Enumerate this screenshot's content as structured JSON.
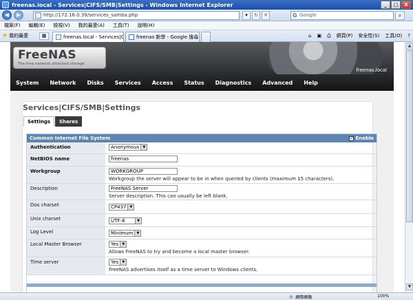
{
  "window": {
    "title": "freenas.local - Services|CIFS/SMB|Settings - Windows Internet Explorer",
    "minimize": "_",
    "maximize": "□",
    "close": "X"
  },
  "browser": {
    "address": "http://172.16.0.39/services_samba.php",
    "search_placeholder": "Google",
    "menu": [
      "檔案(F)",
      "編輯(E)",
      "檢視(V)",
      "我的最愛(A)",
      "工具(T)",
      "說明(H)"
    ],
    "favorites_label": "我的最愛",
    "tabs": [
      {
        "label": "freenas.local - Services|CI...",
        "active": true
      },
      {
        "label": "freenas 新學 - Google 搜尋",
        "active": false
      }
    ],
    "tools": [
      "網頁(P)",
      "安全性(S)",
      "工具(O)"
    ],
    "status_zone": "網際網路",
    "zoom": "100%"
  },
  "header": {
    "logo": "FreeNAS",
    "logo_tagline": "The free network attached storage",
    "hostname": "freenas.local"
  },
  "nav": [
    "System",
    "Network",
    "Disks",
    "Services",
    "Access",
    "Status",
    "Diagnostics",
    "Advanced",
    "Help"
  ],
  "page": {
    "title": "Services|CIFS/SMB|Settings",
    "tabs": [
      "Settings",
      "Shares"
    ]
  },
  "section": {
    "title": "Common Internet File System",
    "enable_label": "Enable",
    "enable_checked": true
  },
  "fields": {
    "authentication": {
      "label": "Authentication",
      "value": "Anonymous"
    },
    "netbios": {
      "label": "NetBIOS name",
      "value": "freenas"
    },
    "workgroup": {
      "label": "Workgroup",
      "value": "WORKGROUP",
      "help": "Workgroup the server will appear to be in when queried by clients (maximum 15 characters)."
    },
    "description": {
      "label": "Description",
      "value": "FreeNAS Server",
      "help": "Server description. This can usually be left blank."
    },
    "dos_charset": {
      "label": "Dos charset",
      "value": "CP437"
    },
    "unix_charset": {
      "label": "Unix charset",
      "value": "UTF-8"
    },
    "log_level": {
      "label": "Log Level",
      "value": "Minimum"
    },
    "local_master": {
      "label": "Local Master Browser",
      "value": "Yes",
      "help": "Allows FreeNAS to try and become a local master browser."
    },
    "time_server": {
      "label": "Time server",
      "value": "Yes",
      "help": "FreeNAS advertises itself as a time server to Windows clients."
    }
  }
}
